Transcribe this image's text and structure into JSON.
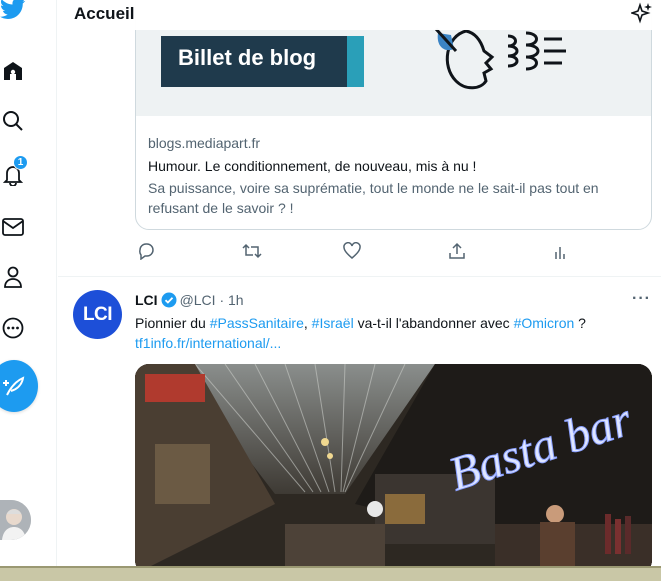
{
  "header": {
    "title": "Accueil"
  },
  "nav": {
    "items": [
      "twitter-logo",
      "home",
      "explore",
      "notifications",
      "messages",
      "profile",
      "more"
    ],
    "notification_count": "1"
  },
  "card": {
    "banner_text": "Billet de blog",
    "domain": "blogs.mediapart.fr",
    "title": "Humour. Le conditionnement, de nouveau, mis à nu !",
    "description": "Sa puissance, voire sa suprématie, tout le monde ne le sait-il pas tout en refusant de le savoir ? !"
  },
  "tweet": {
    "avatar_text": "LCI",
    "name": "LCI",
    "handle": "@LCI",
    "separator": "·",
    "time": "1h",
    "text_1": "Pionnier du ",
    "tag_1": "#PassSanitaire",
    "text_2": ", ",
    "tag_2": "#Israël",
    "text_3": " va-t-il l'abandonner avec ",
    "tag_3": "#Omicron",
    "text_4": " ?",
    "link": "tf1info.fr/international/..."
  },
  "photo_sign": "Basta bar",
  "colors": {
    "accent": "#1d9bf0",
    "text": "#0f1419",
    "muted": "#536471",
    "banner": "#1f3a4c"
  }
}
